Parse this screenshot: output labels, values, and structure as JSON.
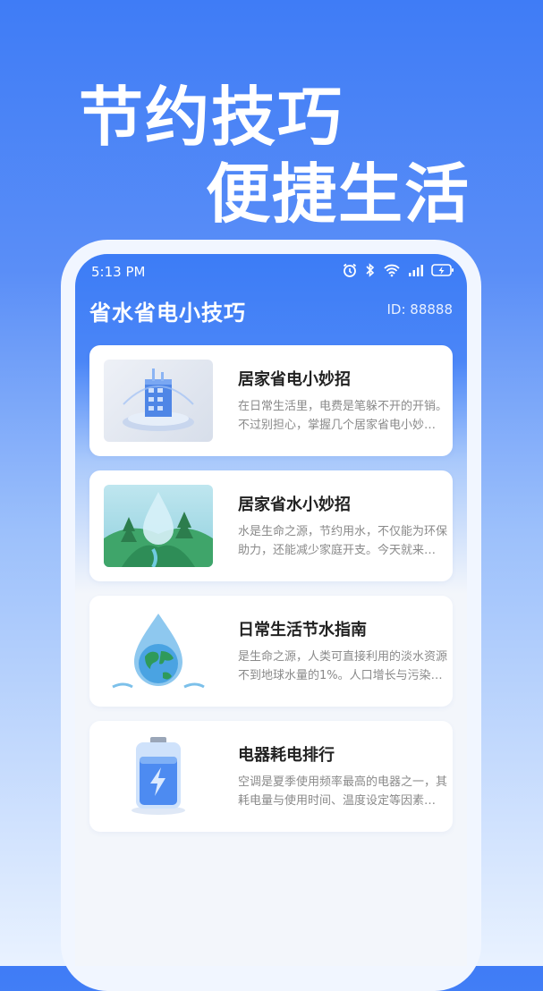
{
  "promo": {
    "line1": "节约技巧",
    "line2": "便捷生活"
  },
  "status_bar": {
    "time": "5:13 PM",
    "icons": [
      "alarm-icon",
      "bluetooth-icon",
      "wifi-icon",
      "signal-icon",
      "battery-charging-icon"
    ]
  },
  "app": {
    "title": "省水省电小技巧",
    "user_id": "ID: 88888"
  },
  "cards": [
    {
      "title": "居家省电小妙招",
      "desc": "在日常生活里，电费是笔躲不开的开销。不过别担心，掌握几个居家省电小妙招就能轻松省钱。",
      "image": "smart-building-illustration"
    },
    {
      "title": "居家省水小妙招",
      "desc": "水是生命之源，节约用水，不仅能为环保助力，还能减少家庭开支。今天就来分享一些实用技巧。",
      "image": "water-drop-forest-illustration"
    },
    {
      "title": "日常生活节水指南",
      "desc": "是生命之源，人类可直接利用的淡水资源不到地球水量的1%。人口增长与污染加剧了短缺。",
      "image": "earth-water-drop-illustration"
    },
    {
      "title": "电器耗电排行",
      "desc": "空调是夏季使用频率最高的电器之一，其耗电量与使用时间、温度设定等因素密切相关。",
      "image": "battery-illustration"
    }
  ],
  "colors": {
    "primary": "#3c7cf6",
    "card_bg": "#ffffff",
    "title_text": "#222222",
    "desc_text": "#8a8a8a"
  }
}
